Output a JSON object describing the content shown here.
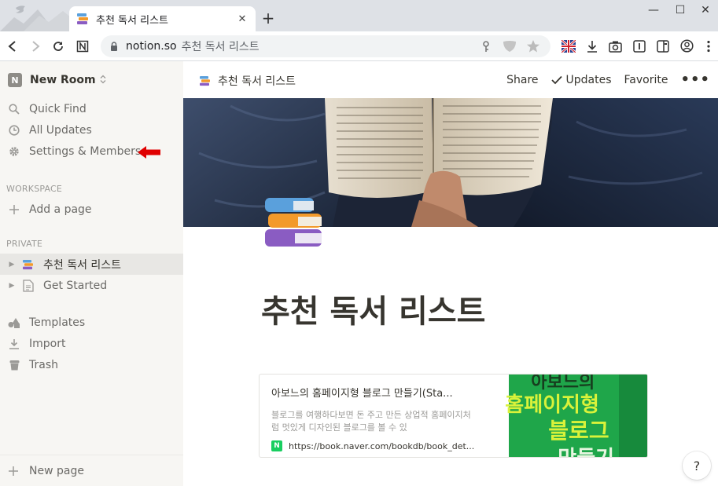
{
  "browser": {
    "tab_title": "추천 독서 리스트",
    "tab_close": "✕",
    "new_tab": "+",
    "url_host": "notion.so",
    "url_path": "추천 독서 리스트",
    "window_controls": [
      "—",
      "☐",
      "✕"
    ]
  },
  "sidebar": {
    "workspace_badge": "N",
    "workspace_name": "New Room",
    "top_items": [
      {
        "label": "Quick Find",
        "icon": "search-icon"
      },
      {
        "label": "All Updates",
        "icon": "clock-icon"
      },
      {
        "label": "Settings & Members",
        "icon": "gear-icon"
      }
    ],
    "workspace_section": "WORKSPACE",
    "add_page": "Add a page",
    "private_section": "PRIVATE",
    "private_pages": [
      {
        "label": "추천 독서 리스트",
        "icon": "books-icon",
        "selected": true
      },
      {
        "label": "Get Started",
        "icon": "page-icon",
        "selected": false
      }
    ],
    "bottom_items": [
      {
        "label": "Templates",
        "icon": "templates-icon"
      },
      {
        "label": "Import",
        "icon": "import-icon"
      },
      {
        "label": "Trash",
        "icon": "trash-icon"
      }
    ],
    "new_page": "New page"
  },
  "topbar": {
    "breadcrumb": "추천 독서 리스트",
    "share": "Share",
    "updates": "Updates",
    "favorite": "Favorite",
    "more": "•••"
  },
  "page": {
    "title": "추천 독서 리스트"
  },
  "bookmark": {
    "title": "아보느의 홈페이지형 블로그 만들기(Sta...",
    "description": "블로그를 여행하다보면 돈 주고 만든 상업적 홈페이지처럼 멋있게 디자인된 블로그를 볼 수 있",
    "favicon": "N",
    "url": "https://book.naver.com/bookdb/book_det...",
    "image_text_line1": "아보느의",
    "image_text_line2": "홈페이지형",
    "image_text_line3": "블로그",
    "image_text_line4": "만들기"
  },
  "help": "?",
  "colors": {
    "sidebar_bg": "#f7f6f3",
    "annotation_arrow": "#e00000",
    "book_cover_green": "#1fa64a"
  }
}
